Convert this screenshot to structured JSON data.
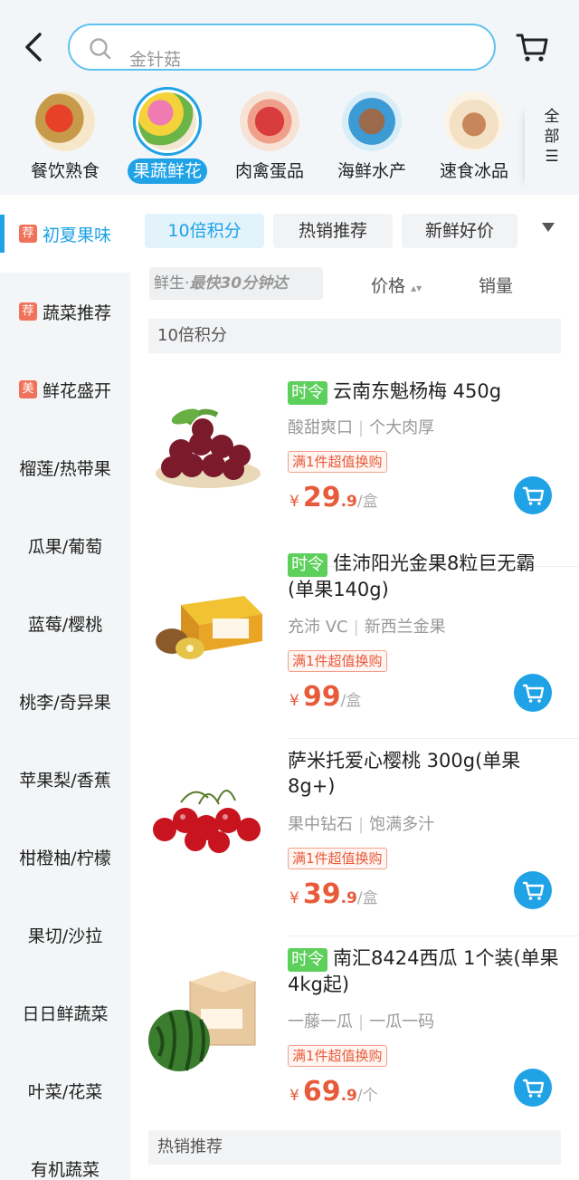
{
  "search": {
    "placeholder": "金针菇"
  },
  "categories": [
    {
      "label": "餐饮熟食",
      "icon": "seafood-dish-icon"
    },
    {
      "label": "果蔬鲜花",
      "icon": "fruit-veg-icon"
    },
    {
      "label": "肉禽蛋品",
      "icon": "meat-icon"
    },
    {
      "label": "海鲜水产",
      "icon": "fish-icon"
    },
    {
      "label": "速食冰品",
      "icon": "dumpling-icon"
    }
  ],
  "all_categories": {
    "line1": "全",
    "line2": "部",
    "line3": "☰"
  },
  "sidebar": [
    {
      "label": "初夏果味",
      "tag": "荐"
    },
    {
      "label": "蔬菜推荐",
      "tag": "荐"
    },
    {
      "label": "鲜花盛开",
      "tag": "美"
    },
    {
      "label": "榴莲/热带果",
      "tag": ""
    },
    {
      "label": "瓜果/葡萄",
      "tag": ""
    },
    {
      "label": "蓝莓/樱桃",
      "tag": ""
    },
    {
      "label": "桃李/奇异果",
      "tag": ""
    },
    {
      "label": "苹果梨/香蕉",
      "tag": ""
    },
    {
      "label": "柑橙柚/柠檬",
      "tag": ""
    },
    {
      "label": "果切/沙拉",
      "tag": ""
    },
    {
      "label": "日日鲜蔬菜",
      "tag": ""
    },
    {
      "label": "叶菜/花菜",
      "tag": ""
    },
    {
      "label": "有机蔬菜",
      "tag": ""
    }
  ],
  "chips": [
    "10倍积分",
    "热销推荐",
    "新鲜好价"
  ],
  "sortbar": {
    "fresh_prefix": "鲜生·",
    "fresh_italic": "最快30分钟达",
    "price": "价格",
    "price_arrows": "▴▾",
    "sales": "销量"
  },
  "sections": {
    "first": "10倍积分",
    "second": "热销推荐"
  },
  "products": [
    {
      "badge": "时令",
      "title": "云南东魁杨梅 450g",
      "tags": [
        "酸甜爽口",
        "个大肉厚"
      ],
      "promo": "满1件超值换购",
      "currency": "¥",
      "price_int": "29",
      "price_dec": ".9",
      "unit": "/盒"
    },
    {
      "badge": "时令",
      "title": "佳沛阳光金果8粒巨无霸(单果140g)",
      "tags": [
        "充沛 VC",
        "新西兰金果"
      ],
      "promo": "满1件超值换购",
      "currency": "¥",
      "price_int": "99",
      "price_dec": "",
      "unit": "/盒"
    },
    {
      "badge": "",
      "title": "萨米托爱心樱桃 300g(单果8g+)",
      "tags": [
        "果中钻石",
        "饱满多汁"
      ],
      "promo": "满1件超值换购",
      "currency": "¥",
      "price_int": "39",
      "price_dec": ".9",
      "unit": "/盒"
    },
    {
      "badge": "时令",
      "title": "南汇8424西瓜 1个装(单果4kg起)",
      "tags": [
        "一藤一瓜",
        "一瓜一码"
      ],
      "promo": "满1件超值换购",
      "currency": "¥",
      "price_int": "69",
      "price_dec": ".9",
      "unit": "/个"
    }
  ],
  "colors": {
    "accent": "#1fa2e6",
    "price": "#e85b3a",
    "badge": "#5cd05a"
  }
}
